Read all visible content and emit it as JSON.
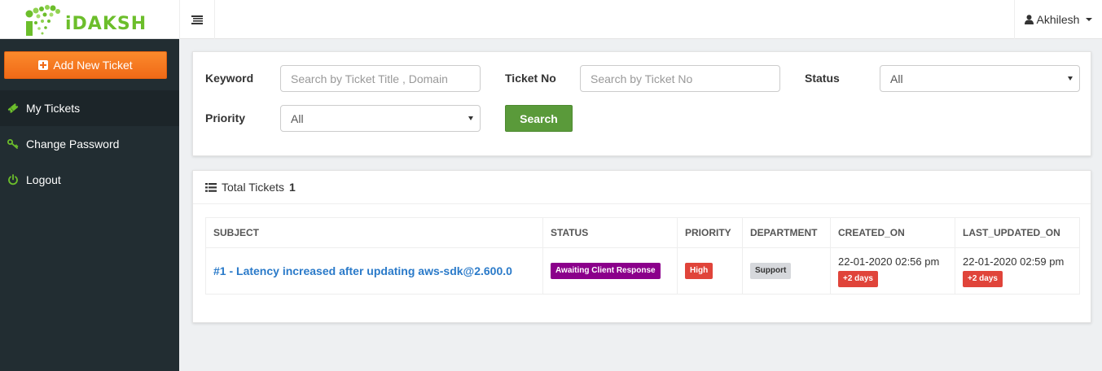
{
  "brand": {
    "name": "iDAKSH",
    "accent": "#6cbe2b"
  },
  "header": {
    "user_name": "Akhilesh",
    "menu_icon": "hamburger-icon",
    "user_icon": "user-icon"
  },
  "sidebar": {
    "add_button": "Add New Ticket",
    "items": [
      {
        "label": "My Tickets",
        "icon": "ticket-icon",
        "active": true
      },
      {
        "label": "Change Password",
        "icon": "key-icon",
        "active": false
      },
      {
        "label": "Logout",
        "icon": "power-icon",
        "active": false
      }
    ]
  },
  "search": {
    "keyword_label": "Keyword",
    "keyword_placeholder": "Search by Ticket Title , Domain",
    "ticket_no_label": "Ticket No",
    "ticket_no_placeholder": "Search by Ticket No",
    "status_label": "Status",
    "status_value": "All",
    "priority_label": "Priority",
    "priority_value": "All",
    "button_label": "Search"
  },
  "tickets": {
    "total_label": "Total Tickets",
    "total_count": "1",
    "columns": [
      "SUBJECT",
      "STATUS",
      "PRIORITY",
      "DEPARTMENT",
      "CREATED_ON",
      "LAST_UPDATED_ON"
    ],
    "rows": [
      {
        "subject": "#1 - Latency increased after updating aws-sdk@2.600.0",
        "status": "Awaiting Client Response",
        "priority": "High",
        "department": "Support",
        "created_on": "22-01-2020 02:56 pm",
        "created_age": "+2 days",
        "updated_on": "22-01-2020 02:59 pm",
        "updated_age": "+2 days"
      }
    ]
  },
  "colors": {
    "sidebar_bg": "#222d32",
    "add_button": "#f47a20",
    "search_button": "#5a9a3a",
    "status_badge": "#8b008b",
    "priority_high": "#e0443a",
    "link": "#2a7ac9"
  }
}
